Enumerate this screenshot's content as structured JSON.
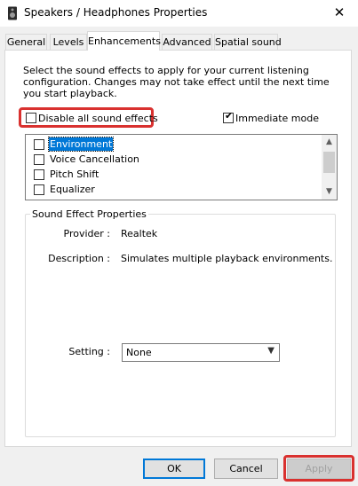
{
  "window": {
    "title": "Speakers / Headphones Properties",
    "close_glyph": "✕"
  },
  "tabs": [
    {
      "label": "General"
    },
    {
      "label": "Levels"
    },
    {
      "label": "Enhancements",
      "active": true
    },
    {
      "label": "Advanced"
    },
    {
      "label": "Spatial sound"
    }
  ],
  "enhancements": {
    "description": "Select the sound effects to apply for your current listening configuration. Changes may not take effect until the next time you start playback.",
    "disable_all": {
      "label": "Disable all sound effects",
      "checked": false
    },
    "immediate_mode": {
      "label": "Immediate mode",
      "checked": true
    },
    "effects": [
      {
        "label": "Environment",
        "checked": false,
        "selected": true
      },
      {
        "label": "Voice Cancellation",
        "checked": false
      },
      {
        "label": "Pitch Shift",
        "checked": false
      },
      {
        "label": "Equalizer",
        "checked": false
      }
    ],
    "properties": {
      "group_title": "Sound Effect Properties",
      "provider_label": "Provider :",
      "provider_value": "Realtek",
      "description_label": "Description :",
      "description_value": "Simulates multiple playback environments.",
      "setting_label": "Setting :",
      "setting_value": "None"
    }
  },
  "buttons": {
    "ok": "OK",
    "cancel": "Cancel",
    "apply": "Apply"
  },
  "colors": {
    "highlight": "#d9312f",
    "selection": "#0078d7"
  },
  "icons": {
    "app": "speaker-icon",
    "close": "close-icon",
    "check": "checkmark-icon",
    "dropdown": "chevron-down-icon"
  }
}
